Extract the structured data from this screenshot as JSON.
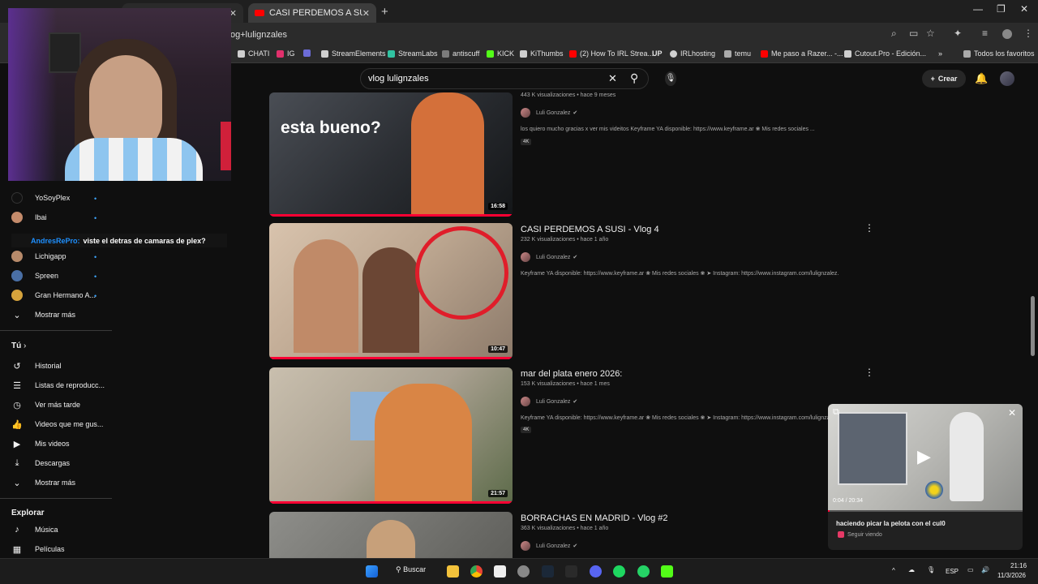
{
  "browser": {
    "tabs": [
      {
        "label": "",
        "close": "✕"
      },
      {
        "label": "CASI PERDEMOS A SUSI - Vlog",
        "close": "✕"
      }
    ],
    "new_tab": "+",
    "url": "og+lulignzales",
    "window_controls": [
      "—",
      "❐",
      "✕"
    ]
  },
  "bookmarks": [
    {
      "label": "CHATI",
      "color": "#cfcfcf"
    },
    {
      "label": "IG",
      "color": "#e1306c"
    },
    {
      "label": "",
      "color": "#6b6bd6"
    },
    {
      "label": "StreamElements",
      "color": "#cfcfcf"
    },
    {
      "label": "StreamLabs",
      "color": "#31c3a2"
    },
    {
      "label": "antiscuff",
      "color": "#7c7c7c"
    },
    {
      "label": "KICK",
      "color": "#53fc18"
    },
    {
      "label": "KiThumbs",
      "color": "#cfcfcf"
    },
    {
      "label": "(2) How To IRL Strea...",
      "color": "#ff0000"
    },
    {
      "label": "UP",
      "color": "#111111"
    },
    {
      "label": "IRLhosting",
      "color": "#cfcfcf"
    },
    {
      "label": "temu",
      "color": "#aaaaaa"
    },
    {
      "label": "Me paso a Razer... -...",
      "color": "#ff0000"
    },
    {
      "label": "Cutout.Pro - Edición...",
      "color": "#cfcfcf"
    },
    {
      "label": "»",
      "color": ""
    },
    {
      "label": "Todos los favoritos",
      "color": "#aaaaaa"
    }
  ],
  "youtube_header": {
    "search_query": "vlog lulignzales",
    "create_label": "Crear"
  },
  "sidebar": {
    "subscriptions": [
      {
        "label": "YoSoyPlex",
        "avatar_color": "#111111",
        "live": true
      },
      {
        "label": "Ibai",
        "avatar_color": "#c48b6b",
        "live": true
      },
      {
        "label": "Lichigapp",
        "avatar_color": "#b78a6a",
        "live": true
      },
      {
        "label": "Spreen",
        "avatar_color": "#4a6fa5",
        "live": true
      },
      {
        "label": "Gran Hermano A...",
        "avatar_color": "#d6a33c",
        "live": true
      }
    ],
    "show_more_1": "Mostrar más",
    "you_section": "Tú",
    "you_items": [
      {
        "label": "Historial",
        "icon": "history-icon"
      },
      {
        "label": "Listas de reproducc...",
        "icon": "playlist-icon"
      },
      {
        "label": "Ver más tarde",
        "icon": "clock-icon"
      },
      {
        "label": "Videos que me gus...",
        "icon": "thumbs-up-icon"
      },
      {
        "label": "Mis videos",
        "icon": "my-videos-icon"
      },
      {
        "label": "Descargas",
        "icon": "download-icon"
      }
    ],
    "show_more_2": "Mostrar más",
    "explore_section": "Explorar",
    "explore_items": [
      {
        "label": "Música",
        "icon": "music-icon"
      },
      {
        "label": "Películas",
        "icon": "film-icon"
      }
    ]
  },
  "chat_overlay": {
    "user": "AndresRePro:",
    "message": "viste el detras de camaras de plex?"
  },
  "videos": [
    {
      "title": "",
      "meta": "443 K visualizaciones • hace 9 meses",
      "channel": "Luli Gonzalez",
      "description": "los quiero mucho gracias x ver mis videitos Keyframe YA disponible: https://www.keyframe.ar ❀ Mis redes sociales ...",
      "badge": "4K",
      "duration": "16:58",
      "thumb_text": "esta bueno?"
    },
    {
      "title": "CASI PERDEMOS A SUSI - Vlog 4",
      "meta": "232 K visualizaciones • hace 1 año",
      "channel": "Luli Gonzalez",
      "description": "Keyframe YA disponible: https://www.keyframe.ar ❀ Mis redes sociales ❀ ➤ Instagram: https://www.instagram.com/lulignzalez.",
      "badge": "",
      "duration": "10:47",
      "thumb_text": ""
    },
    {
      "title": "mar del plata enero 2026:",
      "meta": "153 K visualizaciones • hace 1 mes",
      "channel": "Luli Gonzalez",
      "description": "Keyframe YA disponible: https://www.keyframe.ar ❀ Mis redes sociales ❀ ➤ Instagram: https://www.instagram.com/lulignzalez",
      "badge": "4K",
      "duration": "21:57",
      "thumb_text": ""
    },
    {
      "title": "BORRACHAS EN MADRID - Vlog #2",
      "meta": "363 K visualizaciones • hace 1 año",
      "channel": "Luli Gonzalez",
      "description": "",
      "badge": "",
      "duration": "",
      "thumb_text": ""
    }
  ],
  "miniplayer": {
    "time": "0:04 / 20:34",
    "progress": 0.003,
    "title": "haciendo picar la pelota con el cul0",
    "subtitle": "Seguir viendo"
  },
  "taskbar": {
    "search_label": "Buscar",
    "language": "ESP",
    "time": "21:16",
    "date": "11/3/2026"
  },
  "colors": {
    "youtube_red": "#ff0033",
    "background": "#0f0f0f",
    "link_blue": "#3ea6ff"
  }
}
